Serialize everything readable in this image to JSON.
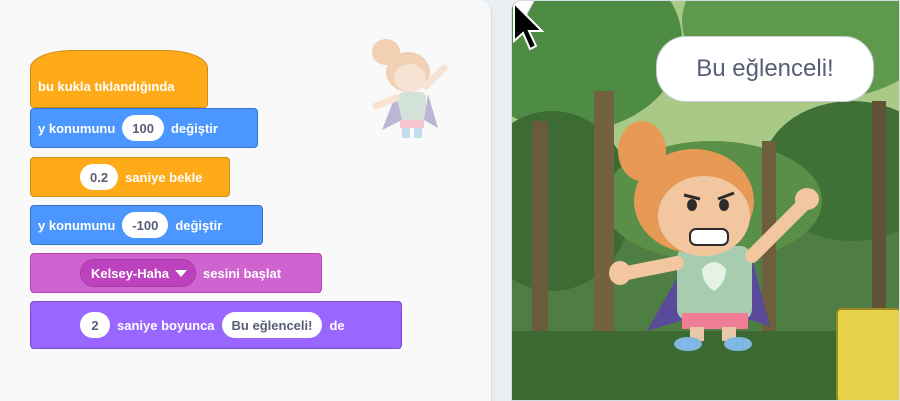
{
  "blocks": {
    "hat": "bu kukla tıklandığında",
    "change_y_1": {
      "prefix": "y konumunu",
      "value": "100",
      "suffix": "değiştir"
    },
    "wait": {
      "value": "0.2",
      "suffix": "saniye bekle"
    },
    "change_y_2": {
      "prefix": "y konumunu",
      "value": "-100",
      "suffix": "değiştir"
    },
    "sound": {
      "option": "Kelsey-Haha",
      "suffix": "sesini başlat"
    },
    "say": {
      "seconds": "2",
      "middle": "saniye boyunca",
      "message": "Bu eğlenceli!",
      "suffix": "de"
    }
  },
  "stage": {
    "speech": "Bu eğlenceli!"
  },
  "colors": {
    "events": "#ffab19",
    "motion": "#4c97ff",
    "sound": "#cf63cf",
    "looks": "#9966ff"
  }
}
